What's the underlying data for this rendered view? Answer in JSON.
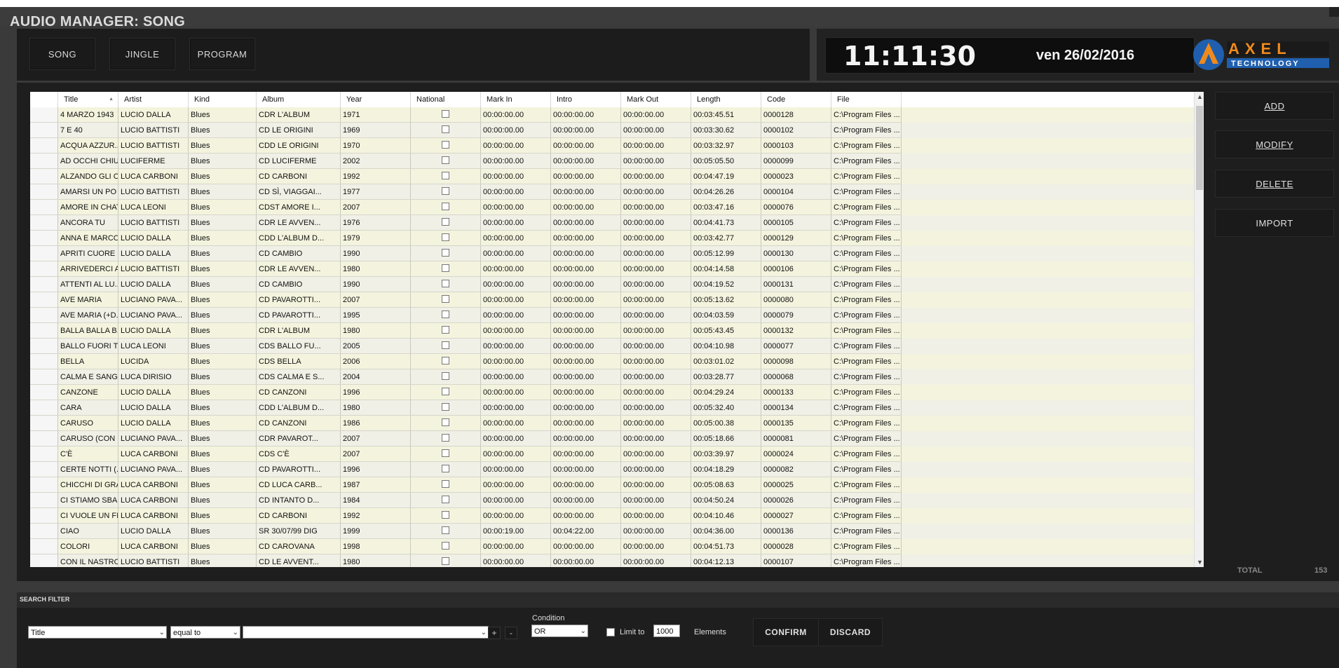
{
  "app": {
    "title": "AUDIO MANAGER: SONG"
  },
  "tabs": [
    {
      "label": "SONG"
    },
    {
      "label": "JINGLE"
    },
    {
      "label": "PROGRAM"
    }
  ],
  "clock": {
    "time": "11:11:30",
    "date": "ven 26/02/2016"
  },
  "logo": {
    "brand": "AXEL",
    "sub": "TECHNOLOGY"
  },
  "grid": {
    "columns": [
      "Title",
      "Artist",
      "Kind",
      "Album",
      "Year",
      "National",
      "Mark In",
      "Intro",
      "Mark Out",
      "Length",
      "Code",
      "File"
    ],
    "rows": [
      [
        "4 MARZO 1943",
        "LUCIO DALLA",
        "Blues",
        "CDR L'ALBUM",
        "1971",
        "00:00:00.00",
        "00:00:00.00",
        "00:00:00.00",
        "00:03:45.51",
        "0000128",
        "C:\\Program Files ..."
      ],
      [
        "7 E 40",
        "LUCIO BATTISTI",
        "Blues",
        "CD LE ORIGINI",
        "1969",
        "00:00:00.00",
        "00:00:00.00",
        "00:00:00.00",
        "00:03:30.62",
        "0000102",
        "C:\\Program Files ..."
      ],
      [
        "ACQUA AZZUR...",
        "LUCIO BATTISTI",
        "Blues",
        "CDD LE ORIGINI",
        "1970",
        "00:00:00.00",
        "00:00:00.00",
        "00:00:00.00",
        "00:03:32.97",
        "0000103",
        "C:\\Program Files ..."
      ],
      [
        "AD OCCHI CHIUSI",
        "LUCIFERME",
        "Blues",
        "CD LUCIFERME",
        "2002",
        "00:00:00.00",
        "00:00:00.00",
        "00:00:00.00",
        "00:05:05.50",
        "0000099",
        "C:\\Program Files ..."
      ],
      [
        "ALZANDO GLI O...",
        "LUCA CARBONI",
        "Blues",
        "CD CARBONI",
        "1992",
        "00:00:00.00",
        "00:00:00.00",
        "00:00:00.00",
        "00:04:47.19",
        "0000023",
        "C:\\Program Files ..."
      ],
      [
        "AMARSI UN PO",
        "LUCIO BATTISTI",
        "Blues",
        "CD SÌ, VIAGGAI...",
        "1977",
        "00:00:00.00",
        "00:00:00.00",
        "00:00:00.00",
        "00:04:26.26",
        "0000104",
        "C:\\Program Files ..."
      ],
      [
        "AMORE IN CHAT",
        "LUCA LEONI",
        "Blues",
        "CDST AMORE I...",
        "2007",
        "00:00:00.00",
        "00:00:00.00",
        "00:00:00.00",
        "00:03:47.16",
        "0000076",
        "C:\\Program Files ..."
      ],
      [
        "ANCORA TU",
        "LUCIO BATTISTI",
        "Blues",
        "CDR LE AVVEN...",
        "1976",
        "00:00:00.00",
        "00:00:00.00",
        "00:00:00.00",
        "00:04:41.73",
        "0000105",
        "C:\\Program Files ..."
      ],
      [
        "ANNA E MARCO",
        "LUCIO DALLA",
        "Blues",
        "CDD L'ALBUM D...",
        "1979",
        "00:00:00.00",
        "00:00:00.00",
        "00:00:00.00",
        "00:03:42.77",
        "0000129",
        "C:\\Program Files ..."
      ],
      [
        "APRITI CUORE",
        "LUCIO DALLA",
        "Blues",
        "CD CAMBIO",
        "1990",
        "00:00:00.00",
        "00:00:00.00",
        "00:00:00.00",
        "00:05:12.99",
        "0000130",
        "C:\\Program Files ..."
      ],
      [
        "ARRIVEDERCI A...",
        "LUCIO BATTISTI",
        "Blues",
        "CDR LE AVVEN...",
        "1980",
        "00:00:00.00",
        "00:00:00.00",
        "00:00:00.00",
        "00:04:14.58",
        "0000106",
        "C:\\Program Files ..."
      ],
      [
        "ATTENTI AL LU...",
        "LUCIO DALLA",
        "Blues",
        "CD CAMBIO",
        "1990",
        "00:00:00.00",
        "00:00:00.00",
        "00:00:00.00",
        "00:04:19.52",
        "0000131",
        "C:\\Program Files ..."
      ],
      [
        "AVE MARIA",
        "LUCIANO PAVA...",
        "Blues",
        "CD PAVAROTTI...",
        "2007",
        "00:00:00.00",
        "00:00:00.00",
        "00:00:00.00",
        "00:05:13.62",
        "0000080",
        "C:\\Program Files ..."
      ],
      [
        "AVE MARIA (+D...",
        "LUCIANO PAVA...",
        "Blues",
        "CD PAVAROTTI...",
        "1995",
        "00:00:00.00",
        "00:00:00.00",
        "00:00:00.00",
        "00:04:03.59",
        "0000079",
        "C:\\Program Files ..."
      ],
      [
        "BALLA BALLA B...",
        "LUCIO DALLA",
        "Blues",
        "CDR L'ALBUM",
        "1980",
        "00:00:00.00",
        "00:00:00.00",
        "00:00:00.00",
        "00:05:43.45",
        "0000132",
        "C:\\Program Files ..."
      ],
      [
        "BALLO FUORI T...",
        "LUCA LEONI",
        "Blues",
        "CDS BALLO FU...",
        "2005",
        "00:00:00.00",
        "00:00:00.00",
        "00:00:00.00",
        "00:04:10.98",
        "0000077",
        "C:\\Program Files ..."
      ],
      [
        "BELLA",
        "LUCIDA",
        "Blues",
        "CDS BELLA",
        "2006",
        "00:00:00.00",
        "00:00:00.00",
        "00:00:00.00",
        "00:03:01.02",
        "0000098",
        "C:\\Program Files ..."
      ],
      [
        "CALMA E SANG...",
        "LUCA DIRISIO",
        "Blues",
        "CDS CALMA E S...",
        "2004",
        "00:00:00.00",
        "00:00:00.00",
        "00:00:00.00",
        "00:03:28.77",
        "0000068",
        "C:\\Program Files ..."
      ],
      [
        "CANZONE",
        "LUCIO DALLA",
        "Blues",
        "CD CANZONI",
        "1996",
        "00:00:00.00",
        "00:00:00.00",
        "00:00:00.00",
        "00:04:29.24",
        "0000133",
        "C:\\Program Files ..."
      ],
      [
        "CARA",
        "LUCIO DALLA",
        "Blues",
        "CDD L'ALBUM D...",
        "1980",
        "00:00:00.00",
        "00:00:00.00",
        "00:00:00.00",
        "00:05:32.40",
        "0000134",
        "C:\\Program Files ..."
      ],
      [
        "CARUSO",
        "LUCIO DALLA",
        "Blues",
        "CD CANZONI",
        "1986",
        "00:00:00.00",
        "00:00:00.00",
        "00:00:00.00",
        "00:05:00.38",
        "0000135",
        "C:\\Program Files ..."
      ],
      [
        "CARUSO (CON L...",
        "LUCIANO PAVA...",
        "Blues",
        "CDR PAVAROT...",
        "2007",
        "00:00:00.00",
        "00:00:00.00",
        "00:00:00.00",
        "00:05:18.66",
        "0000081",
        "C:\\Program Files ..."
      ],
      [
        "C'È",
        "LUCA CARBONI",
        "Blues",
        "CDS C'È",
        "2007",
        "00:00:00.00",
        "00:00:00.00",
        "00:00:00.00",
        "00:03:39.97",
        "0000024",
        "C:\\Program Files ..."
      ],
      [
        "CERTE NOTTI (...",
        "LUCIANO PAVA...",
        "Blues",
        "CD PAVAROTTI...",
        "1996",
        "00:00:00.00",
        "00:00:00.00",
        "00:00:00.00",
        "00:04:18.29",
        "0000082",
        "C:\\Program Files ..."
      ],
      [
        "CHICCHI DI GRA...",
        "LUCA CARBONI",
        "Blues",
        "CD LUCA CARB...",
        "1987",
        "00:00:00.00",
        "00:00:00.00",
        "00:00:00.00",
        "00:05:08.63",
        "0000025",
        "C:\\Program Files ..."
      ],
      [
        "CI STIAMO SBA...",
        "LUCA CARBONI",
        "Blues",
        "CD INTANTO D...",
        "1984",
        "00:00:00.00",
        "00:00:00.00",
        "00:00:00.00",
        "00:04:50.24",
        "0000026",
        "C:\\Program Files ..."
      ],
      [
        "CI VUOLE UN FI...",
        "LUCA CARBONI",
        "Blues",
        "CD CARBONI",
        "1992",
        "00:00:00.00",
        "00:00:00.00",
        "00:00:00.00",
        "00:04:10.46",
        "0000027",
        "C:\\Program Files ..."
      ],
      [
        "CIAO",
        "LUCIO DALLA",
        "Blues",
        "SR 30/07/99 DIG",
        "1999",
        "00:00:19.00",
        "00:04:22.00",
        "00:00:00.00",
        "00:04:36.00",
        "0000136",
        "C:\\Program Files ..."
      ],
      [
        "COLORI",
        "LUCA CARBONI",
        "Blues",
        "CD CAROVANA",
        "1998",
        "00:00:00.00",
        "00:00:00.00",
        "00:00:00.00",
        "00:04:51.73",
        "0000028",
        "C:\\Program Files ..."
      ],
      [
        "CON IL NASTRO...",
        "LUCIO BATTISTI",
        "Blues",
        "CD LE AVVENT...",
        "1980",
        "00:00:00.00",
        "00:00:00.00",
        "00:00:00.00",
        "00:04:12.13",
        "0000107",
        "C:\\Program Files ..."
      ]
    ]
  },
  "actions": {
    "add": "ADD",
    "modify": "MODIFY",
    "delete": "DELETE",
    "import": "IMPORT"
  },
  "total": {
    "label": "TOTAL",
    "value": "153"
  },
  "filter": {
    "title": "SEARCH FILTER",
    "field": "Title",
    "operator": "equal to",
    "value": "",
    "plus": "+",
    "minus": "-",
    "condition_label": "Condition",
    "condition": "OR",
    "limit_label": "Limit to",
    "limit": "1000",
    "elements_label": "Elements",
    "confirm": "CONFIRM",
    "discard": "DISCARD"
  },
  "colors": {
    "row_even": "#f4f4de",
    "row_odd": "#f0f0e6",
    "logo_blue": "#1f5fae",
    "logo_orange": "#f08a1c"
  }
}
